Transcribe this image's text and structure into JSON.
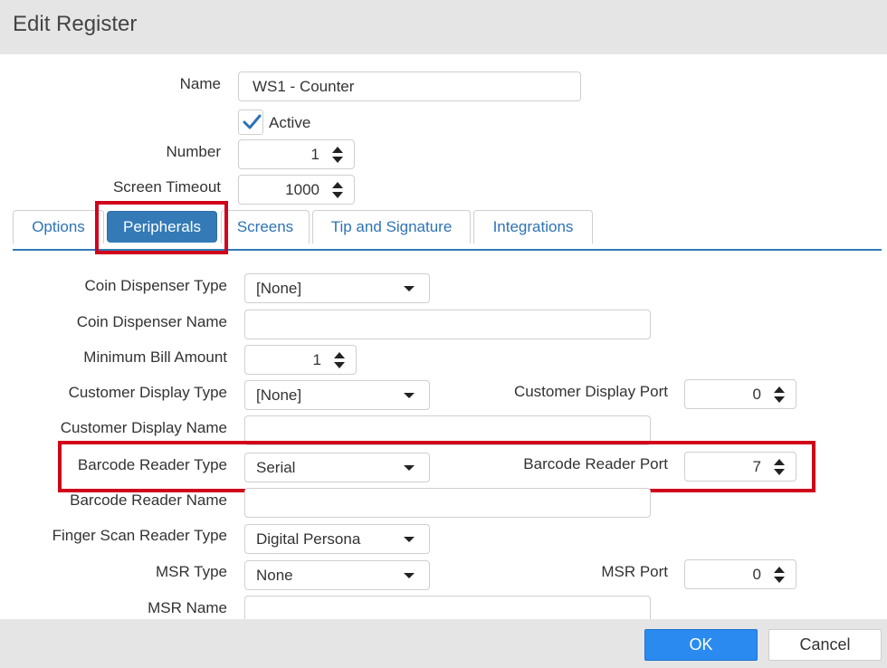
{
  "window": {
    "title": "Edit Register"
  },
  "header_fields": {
    "name_label": "Name",
    "name_value": "WS1 - Counter",
    "active_label": "Active",
    "active_checked": true,
    "number_label": "Number",
    "number_value": "1",
    "timeout_label": "Screen Timeout",
    "timeout_value": "1000"
  },
  "tabs": [
    {
      "label": "Options",
      "active": false
    },
    {
      "label": "Peripherals",
      "active": true
    },
    {
      "label": "Screens",
      "active": false
    },
    {
      "label": "Tip and Signature",
      "active": false
    },
    {
      "label": "Integrations",
      "active": false
    }
  ],
  "peripherals": {
    "coin_dispenser_type_label": "Coin Dispenser Type",
    "coin_dispenser_type_value": "[None]",
    "coin_dispenser_name_label": "Coin Dispenser Name",
    "coin_dispenser_name_value": "",
    "min_bill_label": "Minimum Bill Amount",
    "min_bill_value": "1",
    "customer_display_type_label": "Customer Display Type",
    "customer_display_type_value": "[None]",
    "customer_display_port_label": "Customer Display Port",
    "customer_display_port_value": "0",
    "customer_display_name_label": "Customer Display Name",
    "customer_display_name_value": "",
    "barcode_reader_type_label": "Barcode Reader Type",
    "barcode_reader_type_value": "Serial",
    "barcode_reader_port_label": "Barcode Reader Port",
    "barcode_reader_port_value": "7",
    "barcode_reader_name_label": "Barcode Reader Name",
    "barcode_reader_name_value": "",
    "finger_scan_type_label": "Finger Scan Reader Type",
    "finger_scan_type_value": "Digital Persona",
    "msr_type_label": "MSR Type",
    "msr_type_value": "None",
    "msr_port_label": "MSR Port",
    "msr_port_value": "0",
    "msr_name_label": "MSR Name",
    "msr_name_value": ""
  },
  "footer": {
    "ok_label": "OK",
    "cancel_label": "Cancel"
  },
  "colors": {
    "accent": "#337ab7",
    "highlight": "#d0021b",
    "ok_button": "#2a8af0"
  },
  "icons": {
    "check": "check-icon",
    "spinner": "spinner-arrows-icon",
    "dropdown": "chevron-down-icon"
  }
}
